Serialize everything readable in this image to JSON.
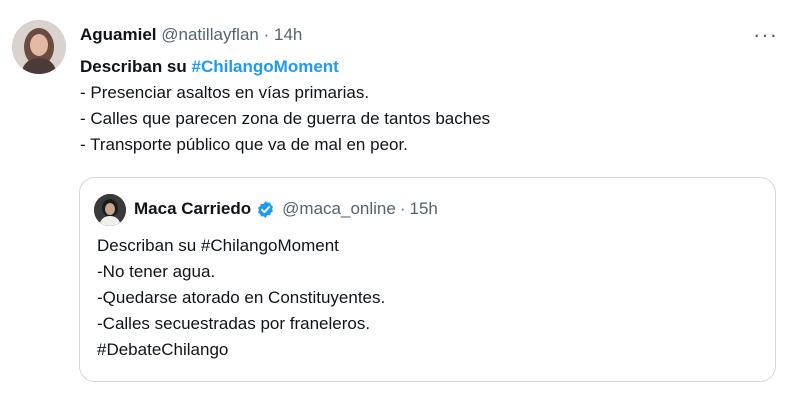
{
  "tweet": {
    "author_name": "Aguamiel",
    "author_handle": "@natillayflan",
    "separator": "·",
    "time": "14h",
    "more_label": "···",
    "text_prefix": "Describan su ",
    "text_hashtag": "#ChilangoMoment",
    "lines": [
      "- Presenciar asaltos en vías primarias.",
      "- Calles que parecen zona de guerra de tantos baches",
      "- Transporte público que va de mal en peor."
    ]
  },
  "quoted_tweet": {
    "author_name": "Maca Carriedo",
    "author_handle": "@maca_online",
    "separator": "·",
    "time": "15h",
    "lines": [
      "Describan su #ChilangoMoment",
      "-No tener agua.",
      "-Quedarse atorado en Constituyentes.",
      "-Calles secuestradas por franeleros.",
      "#DebateChilango"
    ]
  },
  "colors": {
    "accent": "#1d9bf0",
    "text": "#0f1419",
    "secondary_text": "#536471",
    "border": "#cfd9de"
  },
  "icons": {
    "more": "more-horizontal-icon",
    "verified": "verified-badge-icon"
  }
}
